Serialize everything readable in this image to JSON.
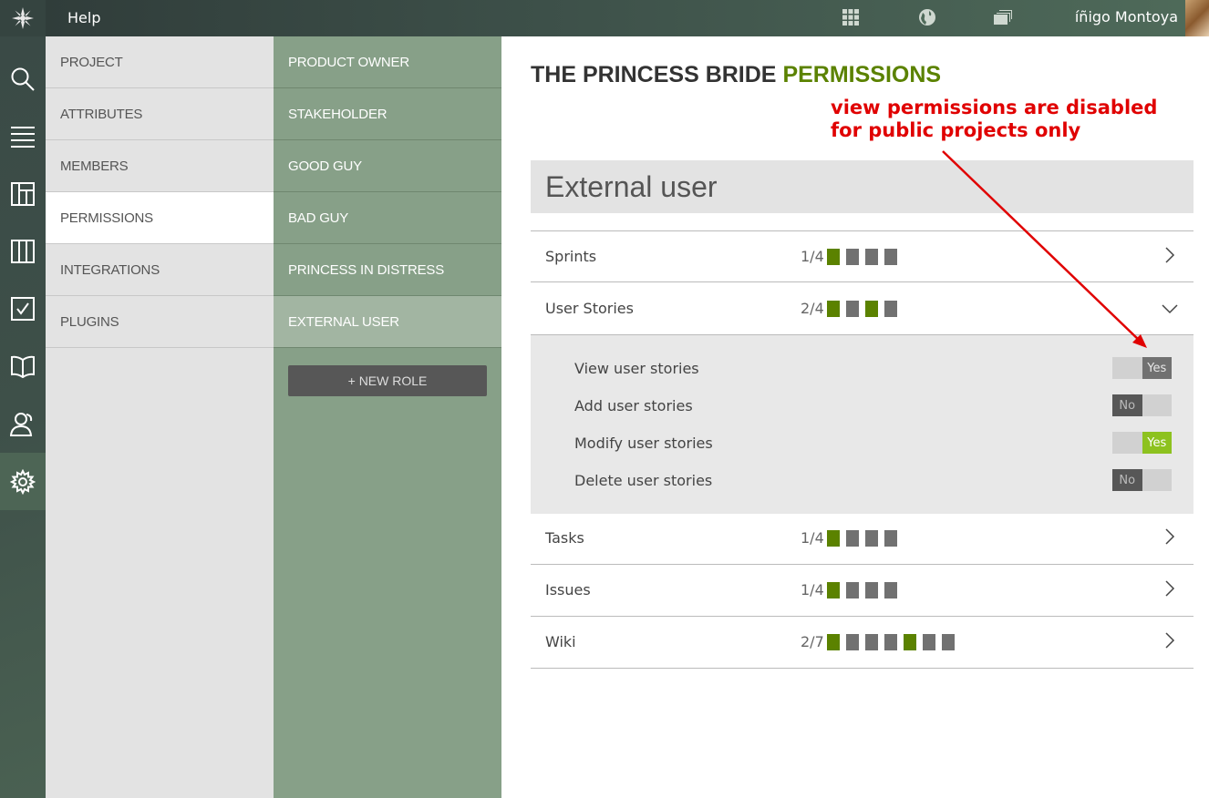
{
  "topbar": {
    "help_label": "Help",
    "icons": [
      "apps-grid-icon",
      "globe-icon",
      "projects-icon"
    ],
    "user_name": "íñigo Montoya"
  },
  "rail": {
    "icons": [
      "search-icon",
      "backlog-icon",
      "kanban-icon",
      "columns-icon",
      "issues-icon",
      "wiki-icon",
      "team-icon",
      "settings-icon"
    ],
    "active": "settings-icon"
  },
  "submenu": {
    "items": [
      "PROJECT",
      "ATTRIBUTES",
      "MEMBERS",
      "PERMISSIONS",
      "INTEGRATIONS",
      "PLUGINS"
    ],
    "active": "PERMISSIONS"
  },
  "roles": {
    "items": [
      "PRODUCT OWNER",
      "STAKEHOLDER",
      "GOOD GUY",
      "BAD GUY",
      "PRINCESS IN DISTRESS",
      "EXTERNAL USER"
    ],
    "active": "EXTERNAL USER",
    "new_role_label": "+ NEW ROLE"
  },
  "main": {
    "title_project": "THE PRINCESS BRIDE",
    "title_section": "PERMISSIONS",
    "role_name": "External user",
    "categories": [
      {
        "name": "Sprints",
        "count": "1/4",
        "pattern": [
          1,
          0,
          0,
          0
        ],
        "expanded": false
      },
      {
        "name": "User Stories",
        "count": "2/4",
        "pattern": [
          1,
          0,
          1,
          0
        ],
        "expanded": true
      },
      {
        "name": "Tasks",
        "count": "1/4",
        "pattern": [
          1,
          0,
          0,
          0
        ],
        "expanded": false
      },
      {
        "name": "Issues",
        "count": "1/4",
        "pattern": [
          1,
          0,
          0,
          0
        ],
        "expanded": false
      },
      {
        "name": "Wiki",
        "count": "2/7",
        "pattern": [
          1,
          0,
          0,
          0,
          1,
          0,
          0
        ],
        "expanded": false
      }
    ],
    "permissions": [
      {
        "label": "View user stories",
        "value": "Yes",
        "state": "yes-disabled"
      },
      {
        "label": "Add user stories",
        "value": "No",
        "state": "no"
      },
      {
        "label": "Modify user stories",
        "value": "Yes",
        "state": "yes"
      },
      {
        "label": "Delete user stories",
        "value": "No",
        "state": "no"
      }
    ]
  },
  "annotation": {
    "line1": "view permissions are disabled",
    "line2": "for public projects only",
    "color": "#e00000"
  },
  "colors": {
    "accent": "#5b8200",
    "role_panel": "#87a088",
    "toggle_yes": "#8dc21f"
  }
}
